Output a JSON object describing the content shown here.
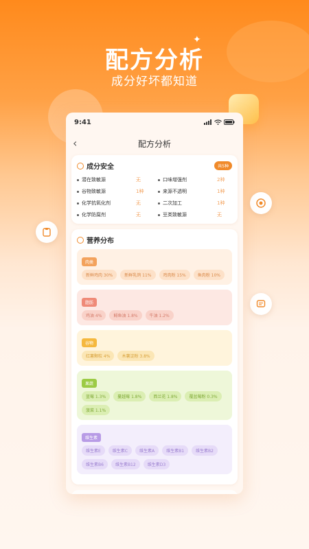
{
  "hero": {
    "title": "配方分析",
    "subtitle": "成分好坏都知道"
  },
  "status_bar": {
    "time": "9:41"
  },
  "nav": {
    "title": "配方分析"
  },
  "safety": {
    "title": "成分安全",
    "badge": "共5种",
    "items": [
      {
        "name": "潜在致敏源",
        "value": "无"
      },
      {
        "name": "口味增强剂",
        "value": "2种"
      },
      {
        "name": "谷物致敏源",
        "value": "1种"
      },
      {
        "name": "来源不透明",
        "value": "1种"
      },
      {
        "name": "化学抗氧化剂",
        "value": "无"
      },
      {
        "name": "二次加工",
        "value": "1种"
      },
      {
        "name": "化学防腐剂",
        "value": "无"
      },
      {
        "name": "豆类致敏源",
        "value": "无"
      }
    ]
  },
  "nutrition": {
    "title": "营养分布",
    "sections": [
      {
        "tag": "肉类",
        "color": "#f3a25c",
        "bg": "#fff1e4",
        "chip_bg": "#fde1c8",
        "chip_fg": "#d98a4a",
        "chips": [
          "新鲜鸡肉 30%",
          "新鲜乳鸽 11%",
          "鸡肉粉 15%",
          "鱼肉粉 10%"
        ]
      },
      {
        "tag": "脂肪",
        "color": "#ef8a78",
        "bg": "#fde8e3",
        "chip_bg": "#f9d2c9",
        "chip_fg": "#d47b6a",
        "chips": [
          "鸡油 4%",
          "鲱鱼油 1.8%",
          "牛油 1.2%"
        ]
      },
      {
        "tag": "谷物",
        "color": "#f5b83e",
        "bg": "#fff4dc",
        "chip_bg": "#fbe6b5",
        "chip_fg": "#d8a13a",
        "chips": [
          "红薯颗粒 4%",
          "木薯淀粉 3.8%"
        ]
      },
      {
        "tag": "果蔬",
        "color": "#9ccb45",
        "bg": "#eef7d9",
        "chip_bg": "#dbeeb3",
        "chip_fg": "#7fa936",
        "chips": [
          "蓝莓 1.3%",
          "蔓越莓 1.8%",
          "西兰花 1.8%",
          "覆盆莓粉 0.3%",
          "菠菜 1.1%"
        ]
      },
      {
        "tag": "维生素",
        "color": "#b89be6",
        "bg": "#f3eefc",
        "chip_bg": "#e6dbf8",
        "chip_fg": "#9c80d0",
        "chips": [
          "维生素E",
          "维生素C",
          "维生素A",
          "维生素B1",
          "维生素B2",
          "维生素B6",
          "维生素B12",
          "维生素D3"
        ]
      }
    ]
  }
}
